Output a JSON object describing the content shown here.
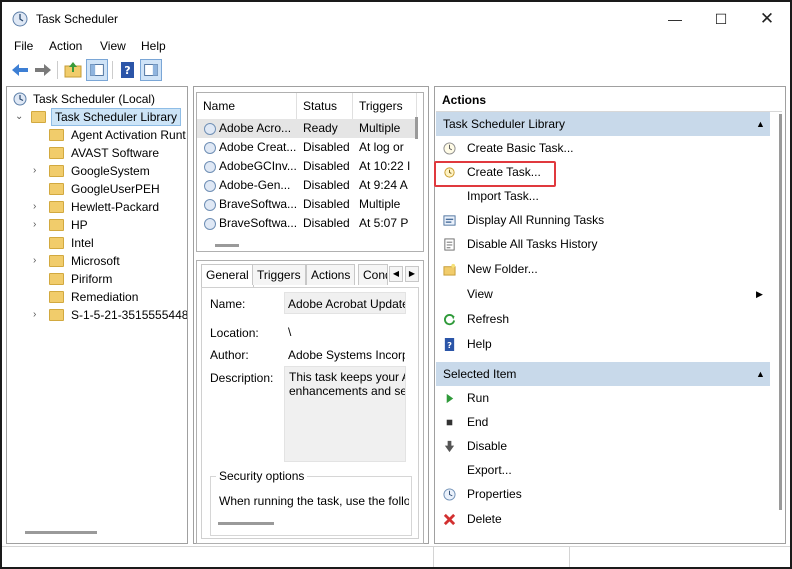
{
  "window": {
    "title": "Task Scheduler"
  },
  "menu": [
    "File",
    "Action",
    "View",
    "Help"
  ],
  "tree": {
    "root": "Task Scheduler (Local)",
    "library": "Task Scheduler Library",
    "folders": [
      {
        "label": "Agent Activation Runt",
        "expandable": false
      },
      {
        "label": "AVAST Software",
        "expandable": false
      },
      {
        "label": "GoogleSystem",
        "expandable": true
      },
      {
        "label": "GoogleUserPEH",
        "expandable": false
      },
      {
        "label": "Hewlett-Packard",
        "expandable": true
      },
      {
        "label": "HP",
        "expandable": true
      },
      {
        "label": "Intel",
        "expandable": false
      },
      {
        "label": "Microsoft",
        "expandable": true
      },
      {
        "label": "Piriform",
        "expandable": false
      },
      {
        "label": "Remediation",
        "expandable": false
      },
      {
        "label": "S-1-5-21-3515555448-",
        "expandable": true
      }
    ]
  },
  "tasklist": {
    "columns": [
      "Name",
      "Status",
      "Triggers"
    ],
    "rows": [
      {
        "name": "Adobe Acro...",
        "status": "Ready",
        "triggers": "Multiple"
      },
      {
        "name": "Adobe Creat...",
        "status": "Disabled",
        "triggers": "At log or"
      },
      {
        "name": "AdobeGCInv...",
        "status": "Disabled",
        "triggers": "At 10:22 I"
      },
      {
        "name": "Adobe-Gen...",
        "status": "Disabled",
        "triggers": "At 9:24 A"
      },
      {
        "name": "BraveSoftwa...",
        "status": "Disabled",
        "triggers": "Multiple"
      },
      {
        "name": "BraveSoftwa...",
        "status": "Disabled",
        "triggers": "At 5:07 P"
      }
    ]
  },
  "properties": {
    "tabs": [
      "General",
      "Triggers",
      "Actions",
      "Cond"
    ],
    "name_label": "Name:",
    "name_value": "Adobe Acrobat Update",
    "location_label": "Location:",
    "location_value": "\\",
    "author_label": "Author:",
    "author_value": "Adobe Systems Incorp",
    "description_label": "Description:",
    "description_line1": "This task keeps your A",
    "description_line2": "enhancements and se",
    "security_heading": "Security options",
    "security_text": "When running the task, use the follo"
  },
  "actions": {
    "header": "Actions",
    "library_section": "Task Scheduler Library",
    "library_items": [
      {
        "label": "Create Basic Task...",
        "icon": "create-basic-task-icon"
      },
      {
        "label": "Create Task...",
        "icon": "create-task-icon"
      },
      {
        "label": "Import Task...",
        "icon": ""
      },
      {
        "label": "Display All Running Tasks",
        "icon": "running-tasks-icon"
      },
      {
        "label": "Disable All Tasks History",
        "icon": "history-icon"
      },
      {
        "label": "New Folder...",
        "icon": "new-folder-icon"
      },
      {
        "label": "View",
        "icon": ""
      },
      {
        "label": "Refresh",
        "icon": "refresh-icon"
      },
      {
        "label": "Help",
        "icon": "help-icon"
      }
    ],
    "selected_section": "Selected Item",
    "selected_items": [
      {
        "label": "Run",
        "icon": "run-icon"
      },
      {
        "label": "End",
        "icon": "end-icon"
      },
      {
        "label": "Disable",
        "icon": "disable-icon"
      },
      {
        "label": "Export...",
        "icon": ""
      },
      {
        "label": "Properties",
        "icon": "properties-icon"
      },
      {
        "label": "Delete",
        "icon": "delete-icon"
      }
    ],
    "highlight_color": "#e0393e"
  }
}
